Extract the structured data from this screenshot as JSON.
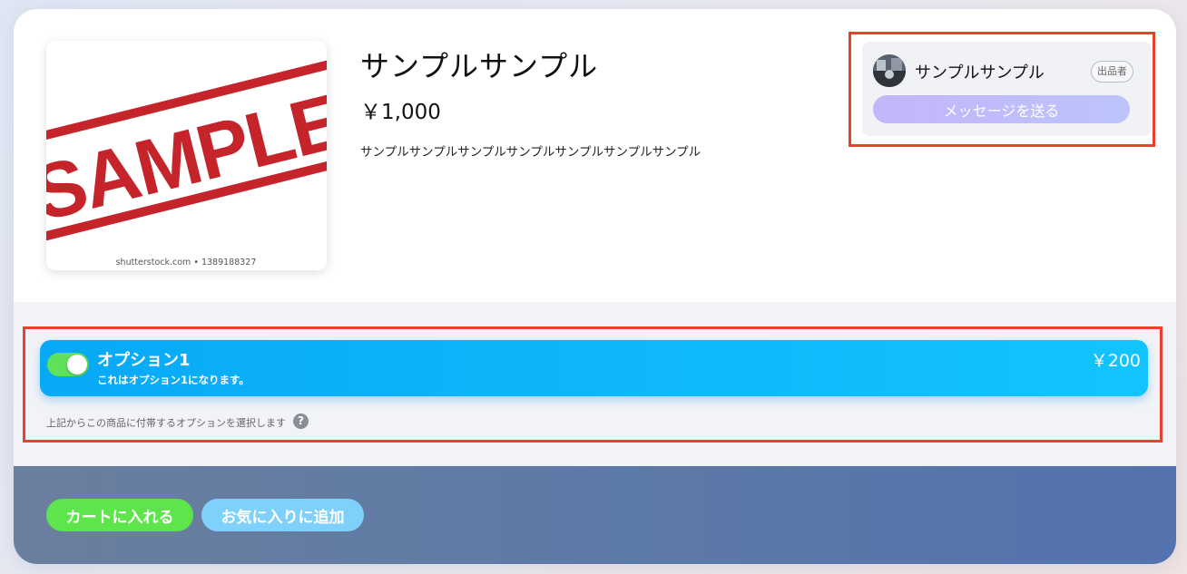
{
  "product": {
    "title": "サンプルサンプル",
    "price": "￥1,000",
    "description": "サンプルサンプルサンプルサンプルサンプルサンプルサンプル",
    "image": {
      "stamp_text": "SAMPLE",
      "watermark": "shutterstock.com • 1389188327"
    }
  },
  "seller": {
    "name": "サンプルサンプル",
    "badge": "出品者",
    "message_button": "メッセージを送る"
  },
  "options": {
    "items": [
      {
        "name": "オプション1",
        "description": "これはオプション1になります。",
        "price": "￥200",
        "enabled": true
      }
    ],
    "hint": "上記からこの商品に付帯するオプションを選択します",
    "help_glyph": "?"
  },
  "actions": {
    "cart_button": "カートに入れる",
    "favorite_button": "お気に入りに追加"
  },
  "colors": {
    "highlight": "#e8412c",
    "option_bar": "#08a9f5",
    "toggle_on": "#5fe25a",
    "cart": "#5ee54c",
    "favorite": "#7fd1fc",
    "message": "#c3b5fb"
  }
}
